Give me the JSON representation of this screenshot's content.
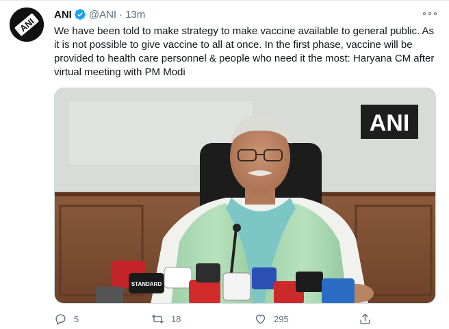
{
  "tweet": {
    "author_name": "ANI",
    "handle": "@ANI",
    "separator": "·",
    "time": "13m",
    "text": "We have been told to make strategy to make vaccine available to general public. As it is not possible to give vaccine to all at once. In the first phase, vaccine will be provided to health care personnel & people who need it the most: Haryana CM after virtual meeting with PM Modi",
    "avatar_logo_text": "ANI",
    "media_watermark": "ANI",
    "media_mic_label": "STANDARD"
  },
  "actions": {
    "reply_count": "5",
    "retweet_count": "18",
    "like_count": "295"
  },
  "icons": {
    "verified": "verified-badge-icon",
    "more": "more-options-icon",
    "reply": "reply-icon",
    "retweet": "retweet-icon",
    "like": "heart-icon",
    "share": "share-icon"
  },
  "colors": {
    "verified_blue": "#1da1f2",
    "muted_text": "#5b7083",
    "primary_text": "#0f1419"
  }
}
